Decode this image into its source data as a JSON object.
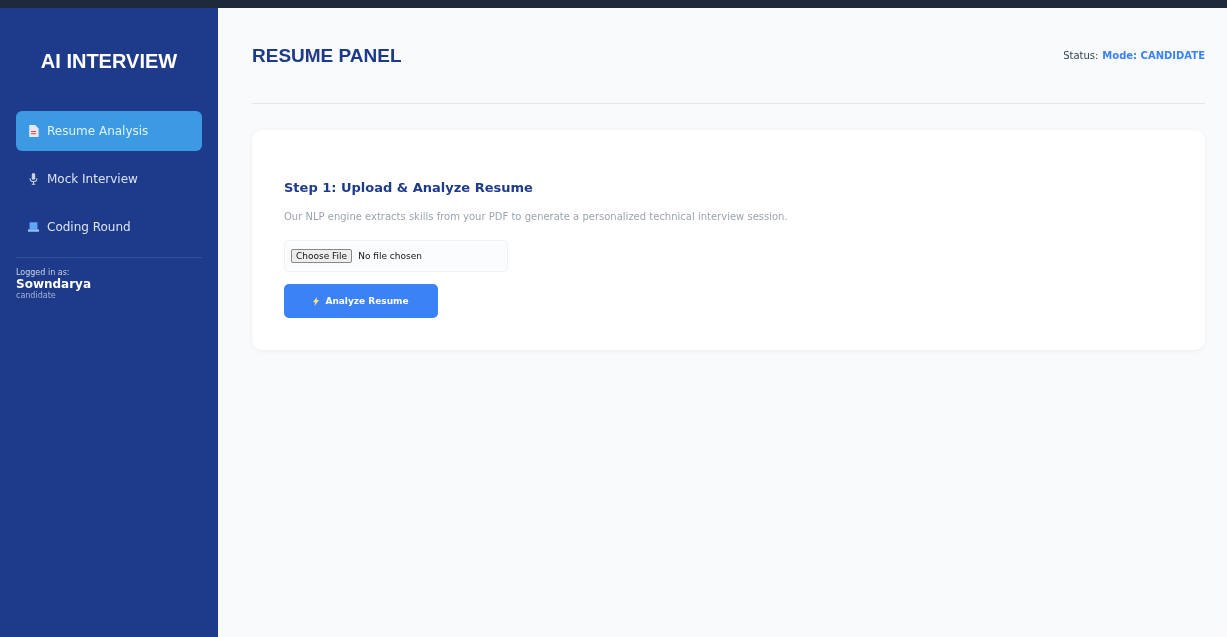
{
  "sidebar": {
    "title": "AI INTERVIEW",
    "items": [
      {
        "label": "Resume Analysis",
        "kind": "document",
        "selected": true
      },
      {
        "label": "Mock Interview",
        "kind": "microphone",
        "selected": false
      },
      {
        "label": "Coding Round",
        "kind": "laptop",
        "selected": false
      }
    ],
    "user": {
      "caption": "Logged in as:",
      "name": "Sowndarya",
      "role": "candidate"
    }
  },
  "header": {
    "title": "RESUME PANEL",
    "status_label": "Status:",
    "status_value": "Mode: CANDIDATE"
  },
  "card": {
    "heading": "Step 1: Upload & Analyze Resume",
    "description": "Our NLP engine extracts skills from your PDF to generate a personalized technical interview session.",
    "file_input": {
      "button": "Choose File",
      "value": "No file chosen"
    },
    "submit": {
      "label": "Analyze Resume"
    }
  }
}
